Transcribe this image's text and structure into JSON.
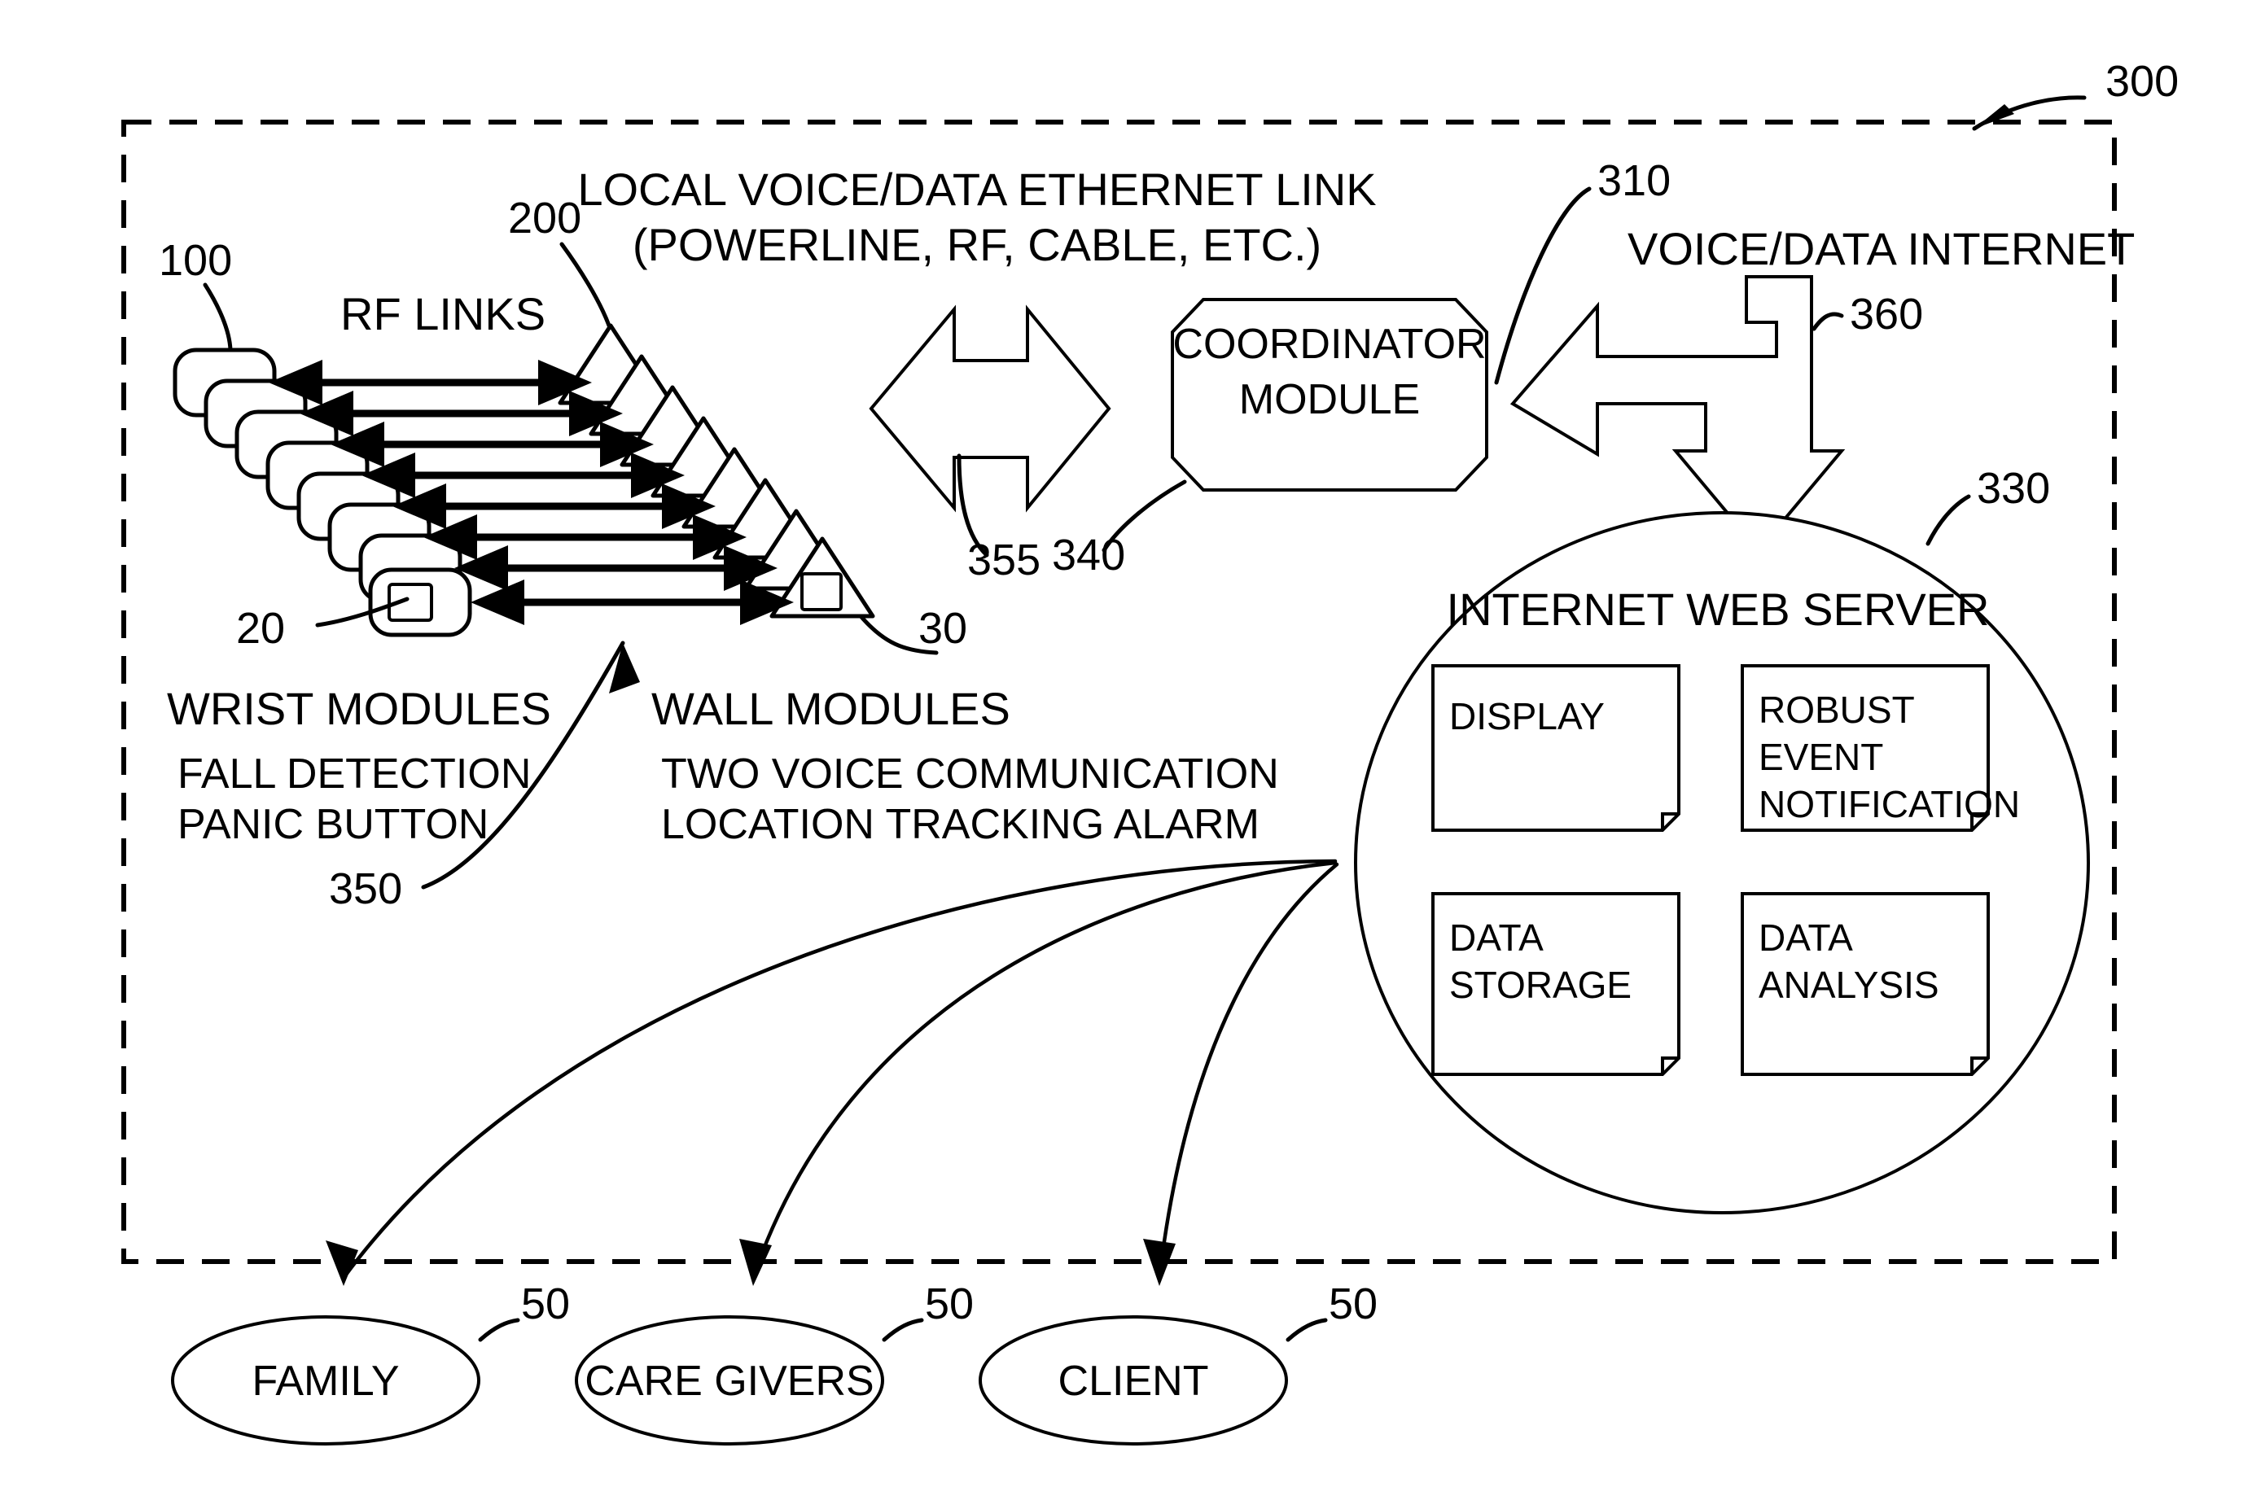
{
  "figure": {
    "number": "300",
    "title": "Remote monitoring system block diagram"
  },
  "boundary": {
    "ref": "300",
    "style": "dashed-rectangle"
  },
  "reference_numerals": {
    "system": "300",
    "wrist_modules": "100",
    "wrist_module_single": "20",
    "wall_modules": "200",
    "wall_module_single": "30",
    "coordinator_module": "310",
    "ethernet_link": "355",
    "coordinator_leader": "340",
    "internet_link": "360",
    "web_server": "330",
    "rf_links_leader": "350",
    "recipients": "50"
  },
  "labels": {
    "rf_links": "RF LINKS",
    "ethernet_link_line1": "LOCAL VOICE/DATA ETHERNET LINK",
    "ethernet_link_line2": "(POWERLINE, RF, CABLE, ETC.)",
    "voice_data_internet": "VOICE/DATA INTERNET",
    "wrist_modules_title": "WRIST MODULES",
    "wrist_modules_feature1": "FALL DETECTION",
    "wrist_modules_feature2": "PANIC BUTTON",
    "wall_modules_title": "WALL MODULES",
    "wall_modules_feature1": "TWO VOICE COMMUNICATION",
    "wall_modules_feature2": "LOCATION TRACKING ALARM"
  },
  "coordinator": {
    "line1": "COORDINATOR",
    "line2": "MODULE",
    "ref": "310"
  },
  "web_server": {
    "title": "INTERNET WEB SERVER",
    "ref": "330",
    "boxes": [
      {
        "id": "display",
        "lines": [
          "DISPLAY"
        ]
      },
      {
        "id": "robust-event-notification",
        "lines": [
          "ROBUST",
          "EVENT",
          "NOTIFICATION"
        ]
      },
      {
        "id": "data-storage",
        "lines": [
          "DATA",
          "STORAGE"
        ]
      },
      {
        "id": "data-analysis",
        "lines": [
          "DATA",
          "ANALYSIS"
        ]
      }
    ]
  },
  "recipients": [
    {
      "id": "family",
      "label": "FAMILY",
      "ref": "50"
    },
    {
      "id": "care-givers",
      "label": "CARE GIVERS",
      "ref": "50"
    },
    {
      "id": "client",
      "label": "CLIENT",
      "ref": "50"
    }
  ],
  "counts": {
    "wrist_modules": 8,
    "wall_modules": 9,
    "rf_link_arrows": 8,
    "recipients": 3,
    "server_boxes": 4
  },
  "colors": {
    "ink": "#000000",
    "paper": "#ffffff"
  }
}
